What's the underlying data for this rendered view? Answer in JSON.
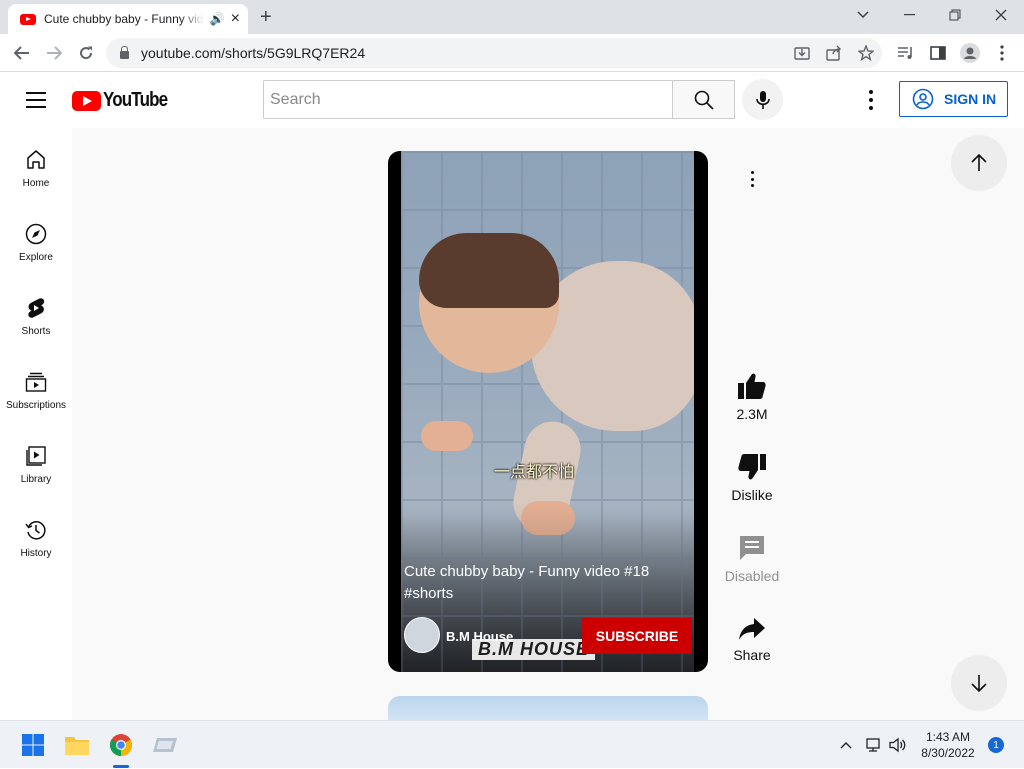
{
  "browser": {
    "tab_title": "Cute chubby baby - Funny video #18 #shorts",
    "tab_icon": "youtube-favicon",
    "url": "youtube.com/shorts/5G9LRQ7ER24"
  },
  "masthead": {
    "logo_text": "YouTube",
    "search_placeholder": "Search",
    "signin_label": "SIGN IN"
  },
  "sidebar": {
    "items": [
      {
        "label": "Home",
        "icon": "home-icon"
      },
      {
        "label": "Explore",
        "icon": "compass-icon"
      },
      {
        "label": "Shorts",
        "icon": "shorts-icon"
      },
      {
        "label": "Subscriptions",
        "icon": "subscriptions-icon"
      },
      {
        "label": "Library",
        "icon": "library-icon"
      },
      {
        "label": "History",
        "icon": "history-icon"
      }
    ]
  },
  "short": {
    "title": "Cute chubby baby - Funny video #18 #shorts",
    "caption": "一点都不怕",
    "channel": "B.M House",
    "watermark": "B.M HOUSE",
    "subscribe_label": "SUBSCRIBE"
  },
  "actions": {
    "like_count": "2.3M",
    "dislike_label": "Dislike",
    "comments_label": "Disabled",
    "share_label": "Share"
  },
  "taskbar": {
    "time": "1:43 AM",
    "date": "8/30/2022",
    "notifications": "1"
  },
  "colors": {
    "youtube_red": "#ff0000",
    "subscribe_red": "#cc0000",
    "signin_blue": "#065fd4"
  }
}
